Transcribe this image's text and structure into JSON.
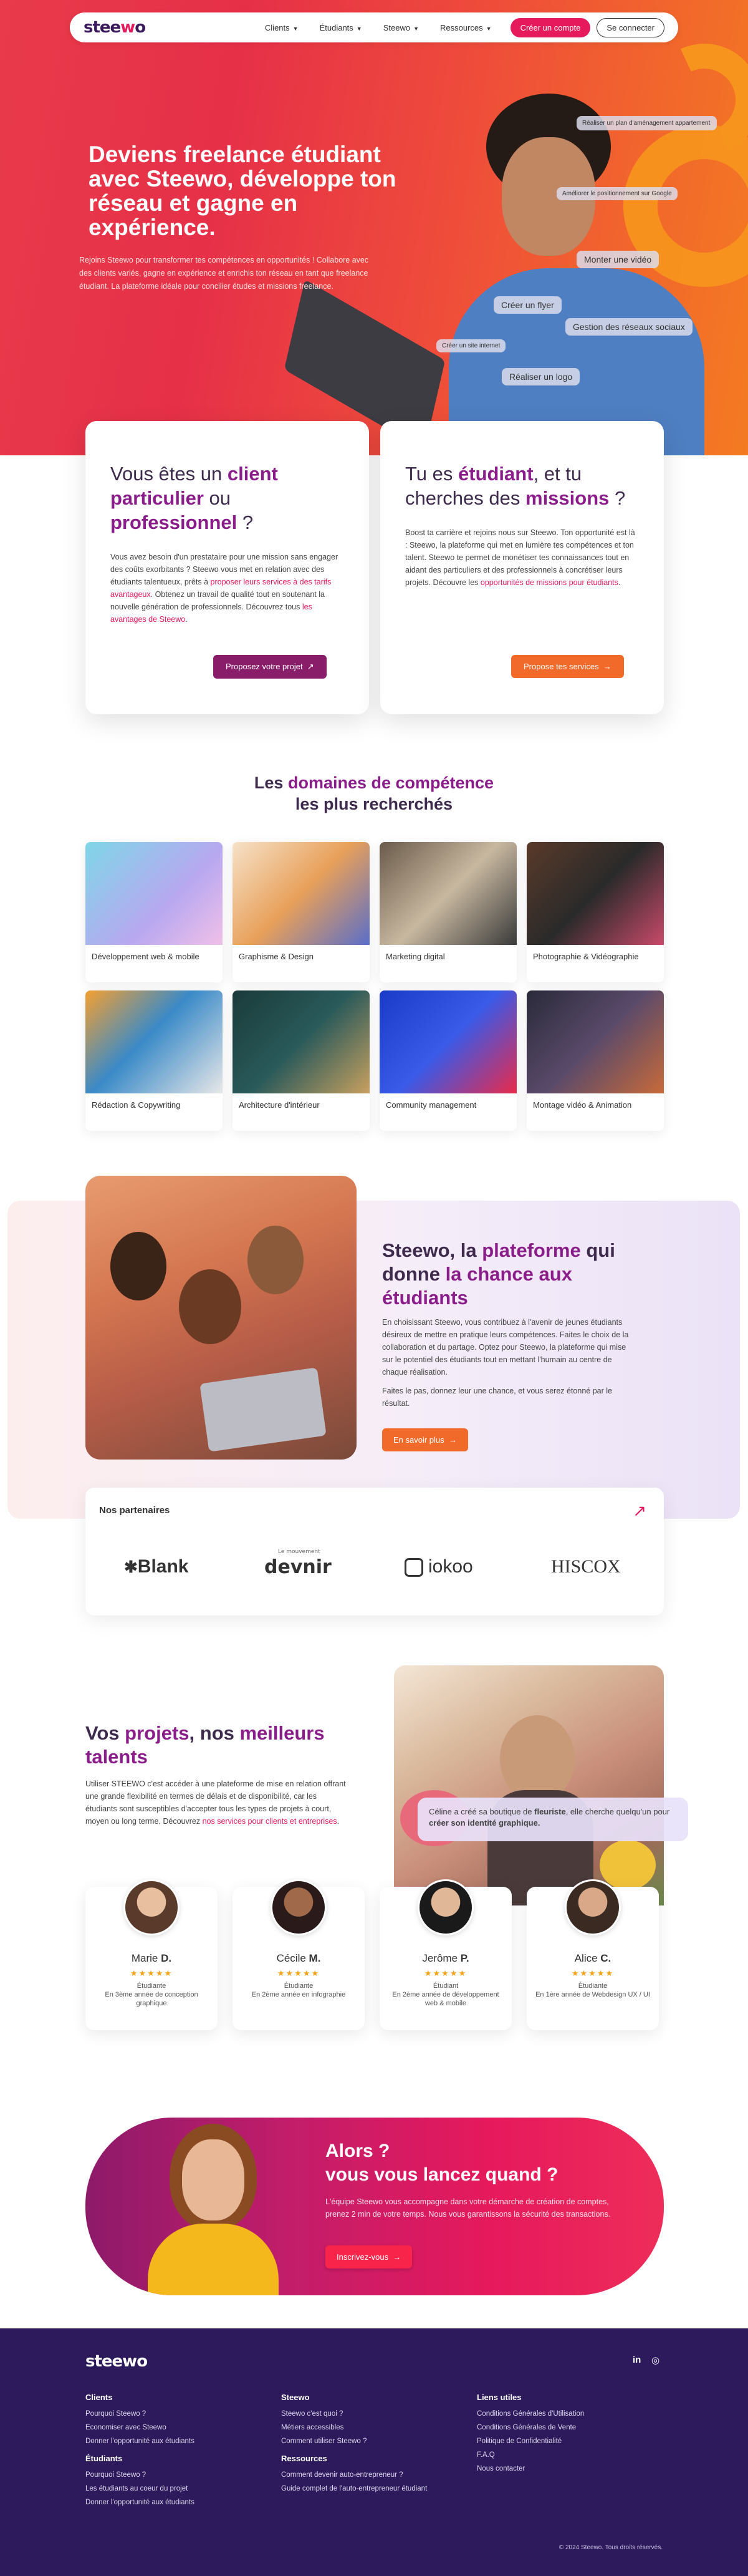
{
  "nav": {
    "logo": "steewo",
    "items": [
      {
        "label": "Clients"
      },
      {
        "label": "Étudiants"
      },
      {
        "label": "Steewo"
      },
      {
        "label": "Ressources"
      }
    ],
    "create_account": "Créer un compte",
    "login": "Se connecter"
  },
  "hero": {
    "title": "Deviens freelance étudiant avec Steewo, développe ton réseau et gagne en expérience.",
    "intro": "Rejoins Steewo pour transformer tes compétences en opportunités ! Collabore avec des clients variés, gagne en expérience et enrichis ton réseau en tant que freelance étudiant. La plateforme idéale pour concilier études et missions freelance.",
    "tags": [
      "Réaliser un plan d'aménagement appartement",
      "Améliorer le positionnement sur Google",
      "Monter une vidéo",
      "Créer un flyer",
      "Gestion des réseaux sociaux",
      "Créer un site internet",
      "Réaliser un logo"
    ]
  },
  "client_card": {
    "t1": "Vous êtes un ",
    "t2": "client particulier",
    "t3": " ou ",
    "t4": "professionnel",
    "t5": " ?",
    "p1": "Vous avez besoin d'un prestataire pour une mission sans engager des coûts exorbitants ? Steewo vous met en relation avec des étudiants talentueux, prêts à ",
    "p2": "proposer leurs services à des tarifs avantageux",
    "p3": ". Obtenez un travail de qualité tout en soutenant la nouvelle génération de professionnels. Découvrez tous ",
    "p4": "les avantages de Steewo",
    "p5": ".",
    "button": "Proposez votre projet"
  },
  "student_card": {
    "t1": "Tu es ",
    "t2": "étudiant",
    "t3": ", et tu cherches des ",
    "t4": "missions",
    "t5": " ?",
    "p1": "Boost ta carrière et rejoins nous sur Steewo. Ton opportunité est là : Steewo, la plateforme qui met en lumière tes compétences et ton talent. Steewo te permet de monétiser tes connaissances tout en aidant des particuliers et des professionnels à concrétiser leurs projets. Découvre les ",
    "p2": "opportunités de missions pour étudiants",
    "p3": ".",
    "button": "Propose tes services"
  },
  "domains": {
    "t1": "Les ",
    "t2": "domaines de compétence",
    "t3": "les plus recherchés",
    "items": [
      {
        "label": "Développement web & mobile"
      },
      {
        "label": "Graphisme & Design"
      },
      {
        "label": "Marketing digital"
      },
      {
        "label": "Photographie & Vidéographie"
      },
      {
        "label": "Rédaction & Copywriting"
      },
      {
        "label": "Architecture d'intérieur"
      },
      {
        "label": "Community management"
      },
      {
        "label": "Montage vidéo & Animation"
      }
    ]
  },
  "platform": {
    "t1": "Steewo, la ",
    "t2": "plateforme",
    "t3": " qui donne ",
    "t4": "la chance aux étudiants",
    "p1": "En choisissant Steewo, vous contribuez à l'avenir de jeunes étudiants désireux de mettre en pratique leurs compétences. Faites le choix de la collaboration et du partage. Optez pour Steewo, la plateforme qui mise sur le potentiel des étudiants tout en mettant l'humain au centre de chaque réalisation.",
    "p2": "Faites le pas, donnez leur une chance, et vous serez étonné par le résultat.",
    "button": "En savoir plus"
  },
  "partners": {
    "title": "Nos partenaires",
    "logos": [
      "Blank",
      "devnir",
      "iokoo",
      "HISCOX"
    ],
    "devnir_small": "Le mouvement"
  },
  "projects": {
    "t1": "Vos ",
    "t2": "projets",
    "t3": ", nos ",
    "t4": "meilleurs talents",
    "p1": "Utiliser STEEWO c'est accéder à une plateforme de mise en relation offrant une grande flexibilité en termes de délais et de disponibilité, car les étudiants sont susceptibles d'accepter tous les types de projets à court, moyen ou long terme. Découvrez ",
    "p2": "nos services pour clients et entreprises",
    "p3": ".",
    "tip1": "Céline a créé sa boutique de ",
    "tip2": "fleuriste",
    "tip3": ", elle cherche quelqu'un pour ",
    "tip4": "créer son identité graphique."
  },
  "students": [
    {
      "first": "Marie ",
      "initial": "D.",
      "stars": "★★★★★",
      "role": "Étudiante\nEn 3ème année de conception graphique"
    },
    {
      "first": "Cécile ",
      "initial": "M.",
      "stars": "★★★★★",
      "role": "Étudiante\nEn 2ème année en infographie"
    },
    {
      "first": "Jerôme ",
      "initial": "P.",
      "stars": "★★★★★",
      "role": "Étudiant\nEn 2ème année de développement web & mobile"
    },
    {
      "first": "Alice ",
      "initial": "C.",
      "stars": "★★★★★",
      "role": "Étudiante\nEn 1ère année de Webdesign UX / UI"
    }
  ],
  "cta": {
    "line1": "Alors ?",
    "line2": "vous vous lancez quand ?",
    "p": "L'équipe Steewo vous accompagne dans votre démarche de création de comptes, prenez 2 min de votre temps. Nous vous garantissons la sécurité des transactions.",
    "button": "Inscrivez-vous"
  },
  "footer": {
    "logo": "steewo",
    "social": [
      "in",
      "◎"
    ],
    "cols": [
      {
        "title": "Clients",
        "links": [
          "Pourquoi Steewo ?",
          "Economiser avec Steewo",
          "Donner l'opportunité aux étudiants"
        ]
      },
      {
        "title": "Étudiants",
        "links": [
          "Pourquoi Steewo ?",
          "Les étudiants au coeur du projet",
          "Donner l'opportunité aux étudiants"
        ]
      },
      {
        "title": "Steewo",
        "links": [
          "Steewo c'est quoi ?",
          "Métiers accessibles",
          "Comment utiliser Steewo ?"
        ]
      },
      {
        "title": "Ressources",
        "links": [
          "Comment devenir auto-entrepreneur ?",
          "Guide complet de l'auto-entrepreneur étudiant"
        ]
      },
      {
        "title": "Liens utiles",
        "links": [
          "Conditions Générales d'Utilisation",
          "Conditions Générales de Vente",
          "Politique de Confidentialité",
          "F.A.Q",
          "Nous contacter"
        ]
      }
    ],
    "copyright": "© 2024 Steewo. Tous droits réservés."
  },
  "colors": {
    "pink": "#e6195c",
    "purple": "#8a1d8a",
    "orange": "#f26a2a",
    "navy": "#2d1a5c"
  },
  "icons": [
    "chevron-down-icon",
    "arrow-right-icon",
    "arrow-up-right-icon",
    "linkedin-icon",
    "instagram-icon",
    "star-icon"
  ]
}
